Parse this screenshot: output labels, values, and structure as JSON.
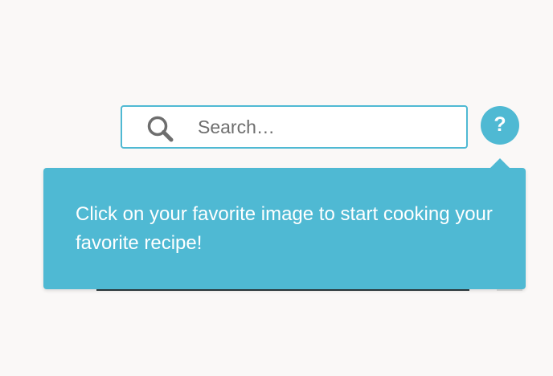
{
  "search": {
    "placeholder": "Search…",
    "icon": "search-icon"
  },
  "help_button": {
    "label": "?",
    "icon": "help-icon"
  },
  "tooltip": {
    "text": "Click on your favorite image to start cooking your favorite recipe!"
  },
  "colors": {
    "accent": "#4fb9d3",
    "background": "#faf8f7",
    "tooltip_text": "#ffffff"
  }
}
